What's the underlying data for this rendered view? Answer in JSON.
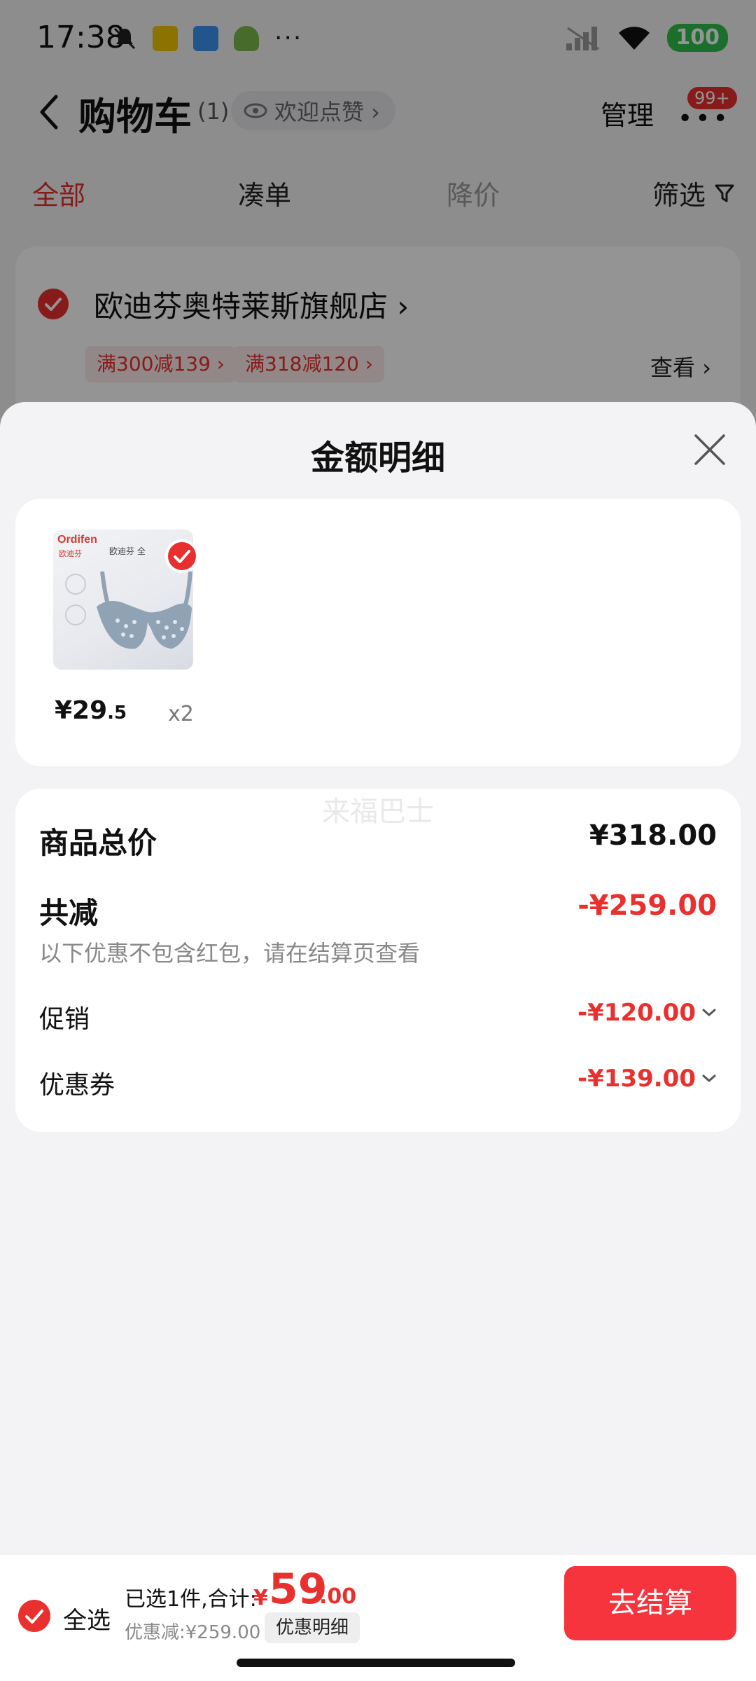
{
  "status_bar": {
    "time": "17:38",
    "icons": [
      "bell-muted-icon",
      "qr-app-icon",
      "notes-app-icon",
      "android-app-icon",
      "more-dots-icon"
    ],
    "dots": "···",
    "battery": "100"
  },
  "nav": {
    "title": "购物车",
    "count": "(1)",
    "like_label": "欢迎点赞 ›",
    "manage_label": "管理",
    "more_badge": "99+"
  },
  "tabs": [
    {
      "label": "全部",
      "active": true
    },
    {
      "label": "凑单",
      "active": false
    },
    {
      "label": "降价",
      "active": false
    }
  ],
  "filter_label": "筛选",
  "store": {
    "name": "欧迪芬奥特莱斯旗舰店 ›",
    "coupons": [
      "满300减139 ›",
      "满318减120 ›"
    ],
    "view_label": "查看 ›"
  },
  "sheet": {
    "title": "金额明细",
    "product": {
      "brand": "Ordifen",
      "brand_cn": "欧迪芬",
      "image_text": "欧迪芬 全",
      "price_int": "¥29",
      "price_dec": ".5",
      "qty": "x2"
    },
    "watermark": "来福巴士",
    "summary": {
      "total_label": "商品总价",
      "total_value": "¥318.00",
      "reduce_label": "共减",
      "reduce_value": "-¥259.00",
      "note": "以下优惠不包含红包，请在结算页查看",
      "promo_label": "促销",
      "promo_value": "-¥120.00",
      "coupon_label": "优惠券",
      "coupon_value": "-¥139.00"
    }
  },
  "bottom": {
    "select_all": "全选",
    "selected_text": "已选1件,合计:",
    "total_currency": "¥",
    "total_int": "59",
    "total_dec": ".00",
    "discount_text": "优惠减:¥259.00",
    "detail_label": "优惠明细",
    "checkout_label": "去结算"
  },
  "colors": {
    "accent_red": "#e8302e",
    "checkout_red": "#f5343d",
    "battery_green": "#2fbe4b"
  }
}
